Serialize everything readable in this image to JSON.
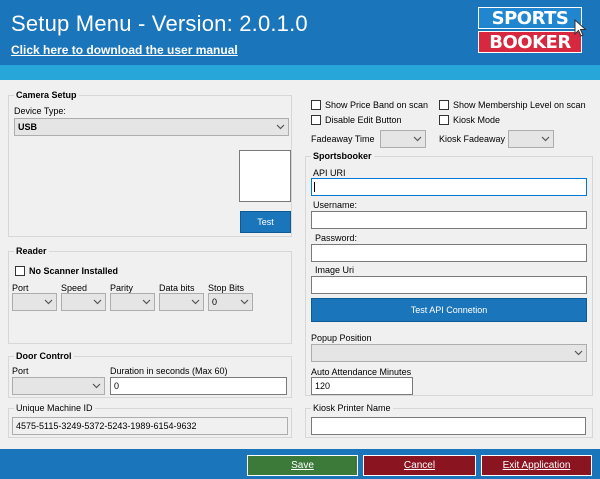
{
  "header": {
    "title": "Setup Menu - Version: 2.0.1.0",
    "manual_link": "Click here to download the user manual",
    "logo_top": "SPORTS",
    "logo_bottom": "BOOKER"
  },
  "camera": {
    "group_title": "Camera Setup",
    "device_type_label": "Device Type:",
    "device_type_value": "USB",
    "test_label": "Test"
  },
  "reader": {
    "group_title": "Reader",
    "no_scanner_label": "No Scanner Installed",
    "port_label": "Port",
    "speed_label": "Speed",
    "parity_label": "Parity",
    "databits_label": "Data bits",
    "stopbits_label": "Stop Bits",
    "stopbits_value": "0"
  },
  "door": {
    "group_title": "Door Control",
    "port_label": "Port",
    "duration_label": "Duration in seconds (Max 60)",
    "duration_value": "0"
  },
  "machine": {
    "group_title": "Unique Machine ID",
    "id_value": "4575-5115-3249-5372-5243-1989-6154-9632"
  },
  "options": {
    "show_price_band": "Show Price Band on scan",
    "show_membership": "Show Membership Level on scan",
    "disable_edit": "Disable Edit Button",
    "kiosk_mode": "Kiosk Mode",
    "fadeaway_time_label": "Fadeaway Time",
    "kiosk_fadeaway_label": "Kiosk Fadeaway"
  },
  "sportsbooker": {
    "group_title": "Sportsbooker",
    "api_uri_label": "API URI",
    "api_uri_value": "",
    "username_label": "Username:",
    "username_value": "",
    "password_label": "Password:",
    "password_value": "",
    "image_uri_label": "Image Uri",
    "image_uri_value": "",
    "test_api_label": "Test API Connetion",
    "popup_position_label": "Popup Position",
    "auto_attendance_label": "Auto Attendance Minutes",
    "auto_attendance_value": "120"
  },
  "kiosk_printer": {
    "group_title": "Kiosk Printer Name",
    "value": ""
  },
  "footer": {
    "save": "Save",
    "cancel": "Cancel",
    "exit": "Exit Application"
  },
  "colors": {
    "header_blue": "#1b75ba",
    "stripe_blue": "#27a6d9",
    "save_green": "#3c7a3a",
    "cancel_red": "#8a1520",
    "exit_red": "#8a1520"
  },
  "icons": {
    "dropdown": "chevron-down-icon",
    "cursor": "cursor-icon"
  }
}
